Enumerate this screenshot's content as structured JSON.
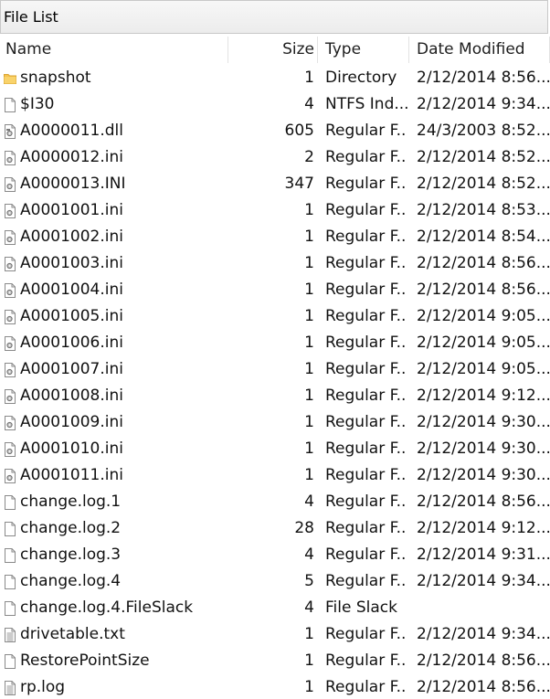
{
  "window": {
    "title": "File List"
  },
  "columns": {
    "name": "Name",
    "size": "Size",
    "type": "Type",
    "date": "Date Modified"
  },
  "colors": {
    "folder": "#f6c350",
    "page": "#ffffff",
    "outline": "#8a8a8a"
  },
  "rows": [
    {
      "icon": "folder-icon",
      "name": "snapshot",
      "size": "1",
      "type": "Directory",
      "date": "2/12/2014 8:56..."
    },
    {
      "icon": "file-icon",
      "name": "$I30",
      "size": "4",
      "type": "NTFS Ind...",
      "date": "2/12/2014 9:34..."
    },
    {
      "icon": "dll-file-icon",
      "name": "A0000011.dll",
      "size": "605",
      "type": "Regular F...",
      "date": "24/3/2003 8:52..."
    },
    {
      "icon": "config-file-icon",
      "name": "A0000012.ini",
      "size": "2",
      "type": "Regular F...",
      "date": "2/12/2014 8:52..."
    },
    {
      "icon": "config-file-icon",
      "name": "A0000013.INI",
      "size": "347",
      "type": "Regular F...",
      "date": "2/12/2014 8:52..."
    },
    {
      "icon": "config-file-icon",
      "name": "A0001001.ini",
      "size": "1",
      "type": "Regular F...",
      "date": "2/12/2014 8:53..."
    },
    {
      "icon": "config-file-icon",
      "name": "A0001002.ini",
      "size": "1",
      "type": "Regular F...",
      "date": "2/12/2014 8:54..."
    },
    {
      "icon": "config-file-icon",
      "name": "A0001003.ini",
      "size": "1",
      "type": "Regular F...",
      "date": "2/12/2014 8:56..."
    },
    {
      "icon": "config-file-icon",
      "name": "A0001004.ini",
      "size": "1",
      "type": "Regular F...",
      "date": "2/12/2014 8:56..."
    },
    {
      "icon": "config-file-icon",
      "name": "A0001005.ini",
      "size": "1",
      "type": "Regular F...",
      "date": "2/12/2014 9:05..."
    },
    {
      "icon": "config-file-icon",
      "name": "A0001006.ini",
      "size": "1",
      "type": "Regular F...",
      "date": "2/12/2014 9:05..."
    },
    {
      "icon": "config-file-icon",
      "name": "A0001007.ini",
      "size": "1",
      "type": "Regular F...",
      "date": "2/12/2014 9:05..."
    },
    {
      "icon": "config-file-icon",
      "name": "A0001008.ini",
      "size": "1",
      "type": "Regular F...",
      "date": "2/12/2014 9:12..."
    },
    {
      "icon": "config-file-icon",
      "name": "A0001009.ini",
      "size": "1",
      "type": "Regular F...",
      "date": "2/12/2014 9:30..."
    },
    {
      "icon": "config-file-icon",
      "name": "A0001010.ini",
      "size": "1",
      "type": "Regular F...",
      "date": "2/12/2014 9:30..."
    },
    {
      "icon": "config-file-icon",
      "name": "A0001011.ini",
      "size": "1",
      "type": "Regular F...",
      "date": "2/12/2014 9:30..."
    },
    {
      "icon": "file-icon",
      "name": "change.log.1",
      "size": "4",
      "type": "Regular F...",
      "date": "2/12/2014 8:56..."
    },
    {
      "icon": "file-icon",
      "name": "change.log.2",
      "size": "28",
      "type": "Regular F...",
      "date": "2/12/2014 9:12..."
    },
    {
      "icon": "file-icon",
      "name": "change.log.3",
      "size": "4",
      "type": "Regular F...",
      "date": "2/12/2014 9:31..."
    },
    {
      "icon": "file-icon",
      "name": "change.log.4",
      "size": "5",
      "type": "Regular F...",
      "date": "2/12/2014 9:34..."
    },
    {
      "icon": "file-icon",
      "name": "change.log.4.FileSlack",
      "size": "4",
      "type": "File Slack",
      "date": ""
    },
    {
      "icon": "text-file-icon",
      "name": "drivetable.txt",
      "size": "1",
      "type": "Regular F...",
      "date": "2/12/2014 9:34..."
    },
    {
      "icon": "file-icon",
      "name": "RestorePointSize",
      "size": "1",
      "type": "Regular F...",
      "date": "2/12/2014 8:56..."
    },
    {
      "icon": "text-file-icon",
      "name": "rp.log",
      "size": "1",
      "type": "Regular F...",
      "date": "2/12/2014 8:56..."
    }
  ]
}
